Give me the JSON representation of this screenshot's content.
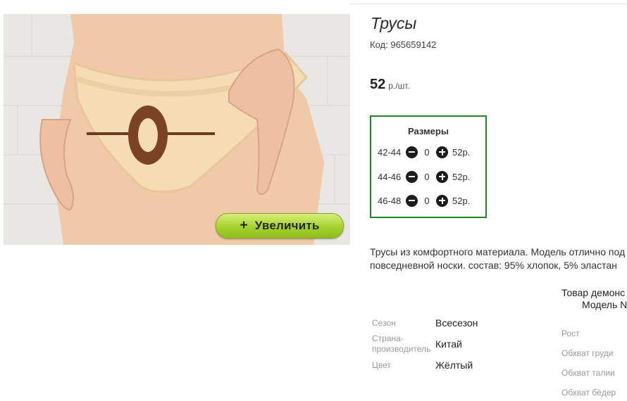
{
  "product": {
    "title": "Трусы",
    "code_label": "Код:",
    "code_value": "965659142",
    "price": "52",
    "price_unit": "р./шт.",
    "zoom_button": "Увеличить",
    "zoom_icon": "plus"
  },
  "sizes": {
    "title": "Размеры",
    "rows": [
      {
        "label": "42-44",
        "qty": "0",
        "price": "52р."
      },
      {
        "label": "44-46",
        "qty": "0",
        "price": "52р."
      },
      {
        "label": "46-48",
        "qty": "0",
        "price": "52р."
      }
    ]
  },
  "description": {
    "line1": "Трусы из комфортного материала. Модель отлично под",
    "line2": "повседневной носки. состав: 95% хлопок, 5% эластан"
  },
  "attributes": [
    {
      "label": "Сезон",
      "value": "Всесезон"
    },
    {
      "label": "Страна-производитель",
      "label_line1": "Страна-",
      "label_line2": "производитель",
      "value": "Китай"
    },
    {
      "label": "Цвет",
      "value": "Жёлтый"
    }
  ],
  "model": {
    "line1": "Товар демонс",
    "line2": "Модель N",
    "measurements": [
      "Рост",
      "Обхват груди",
      "Обхват талии",
      "Обхват бёдер"
    ]
  },
  "colors": {
    "border_green": "#1e8a1e",
    "button_green": "#a6d12e"
  }
}
